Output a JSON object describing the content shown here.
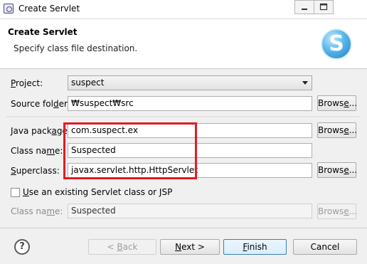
{
  "window": {
    "title": "Create Servlet"
  },
  "header": {
    "title": "Create Servlet",
    "message": "Specify class file destination.",
    "logo_letter": "S"
  },
  "form": {
    "project": {
      "label_pre": "",
      "label_mnemonic": "P",
      "label_post": "roject:",
      "value": "suspect"
    },
    "source_folder": {
      "label_pre": "Source fol",
      "label_mnemonic": "d",
      "label_post": "er:",
      "value": "₩suspect₩src"
    },
    "java_package": {
      "label_pre": "Java pack",
      "label_mnemonic": "a",
      "label_post": "ge:",
      "value": "com.suspect.ex"
    },
    "class_name": {
      "label_pre": "Class na",
      "label_mnemonic": "m",
      "label_post": "e:",
      "value": "Suspected"
    },
    "superclass": {
      "label_pre": "",
      "label_mnemonic": "S",
      "label_post": "uperclass:",
      "value": "javax.servlet.http.HttpServlet"
    },
    "use_existing": {
      "label_pre": "",
      "label_mnemonic": "U",
      "label_post": "se an existing Servlet class or JSP",
      "checked": false
    },
    "existing_class_name": {
      "label_pre": "Class na",
      "label_mnemonic": "m",
      "label_post": "e:",
      "value": "Suspected"
    },
    "browse": {
      "label_pre": "Brows",
      "label_mnemonic": "e",
      "label_post": "..."
    }
  },
  "buttons": {
    "back": {
      "label_pre": "< ",
      "label_mnemonic": "B",
      "label_post": "ack"
    },
    "next": {
      "label_pre": "",
      "label_mnemonic": "N",
      "label_post": "ext >"
    },
    "finish": {
      "label_pre": "",
      "label_mnemonic": "F",
      "label_post": "inish"
    },
    "cancel": {
      "label_pre": "Cancel",
      "label_mnemonic": "",
      "label_post": ""
    },
    "help": "?"
  },
  "icons": {
    "app": "eclipse-app-icon",
    "minimize": "minimize-icon",
    "maximize": "maximize-icon",
    "dropdown": "chevron-down-icon",
    "help": "help-icon",
    "logo": "servlet-logo-icon"
  },
  "colors": {
    "highlight": "#e31b23",
    "default_button_border": "#3c7fb1",
    "logo": "#3aa3e0"
  }
}
